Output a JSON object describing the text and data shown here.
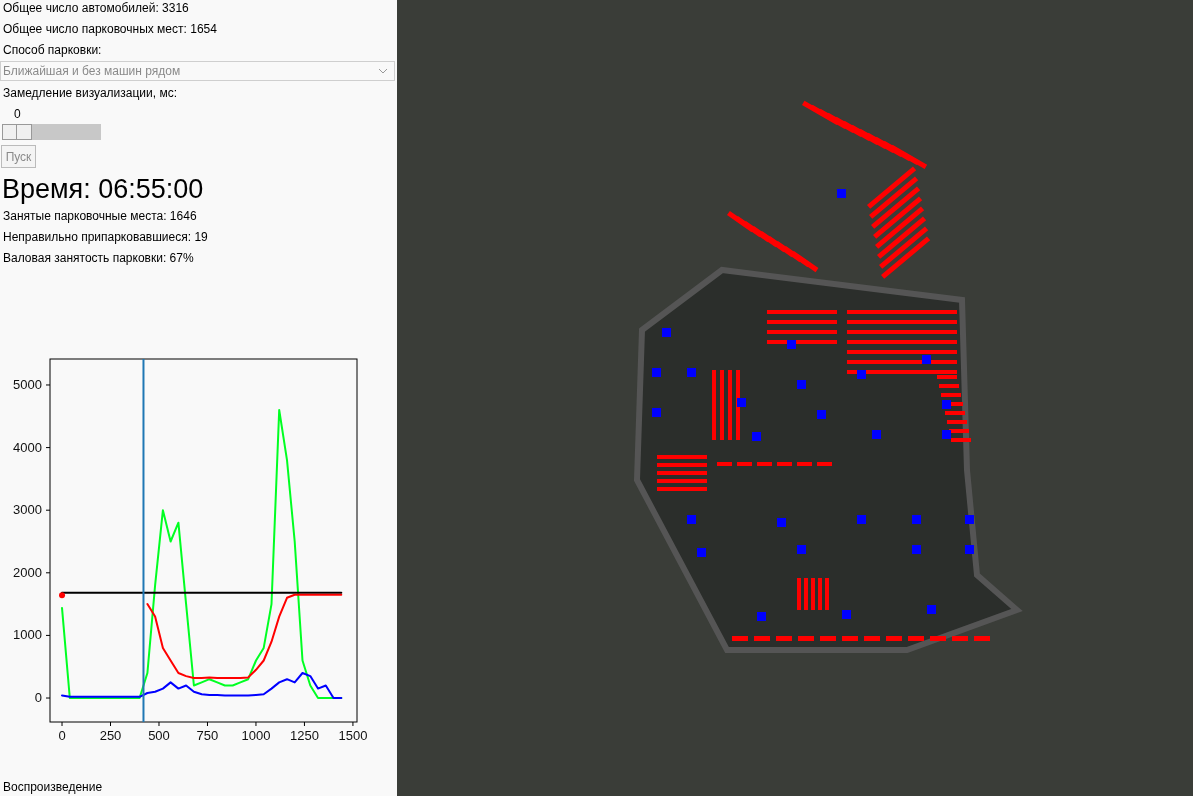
{
  "stats_top": [
    "Общее число автомобилей: 3316",
    "Общее число парковочных мест: 1654"
  ],
  "parking_mode": {
    "label": "Способ парковки:",
    "value": "Ближайшая и без машин рядом",
    "disabled": true
  },
  "delay": {
    "label": "Замедление визуализации, мс:",
    "reading": "0",
    "level": 0
  },
  "start_button": {
    "label": "Пуск",
    "disabled": true
  },
  "time": "Время: 06:55:00",
  "stats": [
    "Занятые парковочные места: 1646",
    "Неправильно припарковавшиеся: 19",
    "Валовая занятость парковки: 67%"
  ],
  "chart_data": {
    "type": "line",
    "x": [
      0,
      40,
      80,
      120,
      160,
      200,
      240,
      280,
      320,
      360,
      400,
      440,
      480,
      520,
      560,
      600,
      640,
      680,
      720,
      760,
      800,
      840,
      880,
      920,
      960,
      1000,
      1040,
      1080,
      1120,
      1160,
      1200,
      1240,
      1280,
      1320,
      1360,
      1400,
      1440
    ],
    "xlim": [
      -62,
      1521
    ],
    "ylim": [
      -383,
      5415
    ],
    "xticks": [
      0,
      250,
      500,
      750,
      1000,
      1250,
      1500
    ],
    "yticks": [
      0,
      1000,
      2000,
      3000,
      4000,
      5000
    ],
    "series": [
      {
        "color": "#00ff22",
        "values": [
          1440,
          0,
          0,
          0,
          0,
          0,
          0,
          0,
          0,
          0,
          0,
          400,
          1800,
          3000,
          2500,
          2800,
          1500,
          200,
          250,
          300,
          250,
          200,
          200,
          250,
          300,
          600,
          800,
          1500,
          4600,
          3800,
          2500,
          600,
          200,
          0,
          0,
          0,
          0
        ]
      },
      {
        "color": "#000000",
        "values": [
          1680,
          1680,
          1680,
          1680,
          1680,
          1680,
          1680,
          1680,
          1680,
          1680,
          1680,
          1680,
          1680,
          1680,
          1680,
          1680,
          1680,
          1680,
          1680,
          1680,
          1680,
          1680,
          1680,
          1680,
          1680,
          1680,
          1680,
          1680,
          1680,
          1680,
          1680,
          1680,
          1680,
          1680,
          1680,
          1680,
          1680
        ]
      },
      {
        "color": "#ff0000",
        "values": [
          1640,
          null,
          null,
          null,
          null,
          null,
          null,
          null,
          null,
          null,
          null,
          1500,
          1300,
          800,
          600,
          400,
          350,
          320,
          320,
          330,
          320,
          320,
          320,
          320,
          330,
          450,
          600,
          900,
          1300,
          1600,
          1650,
          1650,
          1650,
          1650,
          1650,
          1650,
          1650
        ]
      },
      {
        "color": "#0000ff",
        "values": [
          40,
          20,
          20,
          20,
          20,
          20,
          20,
          20,
          20,
          20,
          20,
          80,
          100,
          150,
          250,
          150,
          200,
          100,
          60,
          50,
          50,
          40,
          40,
          40,
          40,
          50,
          60,
          150,
          250,
          300,
          250,
          400,
          350,
          150,
          200,
          0,
          0
        ]
      }
    ],
    "ref_lines": [
      {
        "axis": "x",
        "value": 420,
        "color": "#1f77b4"
      }
    ]
  },
  "playback_label": "Воспроизведение"
}
